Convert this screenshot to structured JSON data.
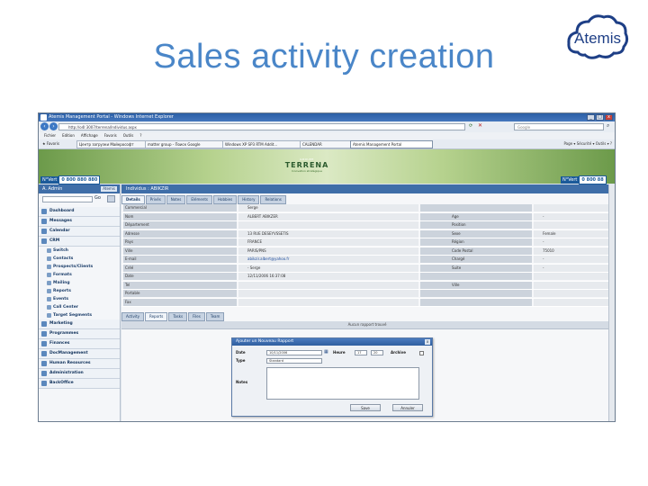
{
  "slide": {
    "title": "Sales activity creation",
    "logo_text": "Atemis"
  },
  "browser": {
    "window_title": "Atemis Management Portal - Windows Internet Explorer",
    "address": "http://o4l:3007/terrena/Individus.aspx",
    "search_placeholder": "Google",
    "menu": [
      "Fichier",
      "Edition",
      "Affichage",
      "Favoris",
      "Outils",
      "?"
    ],
    "favorites_label": "Favoris",
    "tabs": [
      "Центр загрузки Майкрософт",
      "matter group - Поиск Google",
      "Windows XP SP3 RTM Addit...",
      "CALENDAR",
      "Atemis Management Portal"
    ],
    "page_tools": "Page ▾  Sécurité ▾  Outils ▾  ?"
  },
  "banner": {
    "group_text": "GROUPE",
    "brand": "TERRENA",
    "tagline": "Innovation stratégique",
    "phone_tag": "N°Vert",
    "phone_number": "0 800 880 880",
    "phone_number_right": "0 800 88"
  },
  "sidebar": {
    "user": "A. Admin",
    "badge": "Atemis",
    "go_label": "Go",
    "items": [
      {
        "label": "Dashboard",
        "level": "top"
      },
      {
        "label": "Messages",
        "level": "top"
      },
      {
        "label": "Calendar",
        "level": "top"
      },
      {
        "label": "CRM",
        "level": "top"
      },
      {
        "label": "Switch",
        "level": "sub"
      },
      {
        "label": "Contacts",
        "level": "sub"
      },
      {
        "label": "Prospects/Clients",
        "level": "sub"
      },
      {
        "label": "Formats",
        "level": "sub"
      },
      {
        "label": "Mailing",
        "level": "sub"
      },
      {
        "label": "Reports",
        "level": "sub"
      },
      {
        "label": "Events",
        "level": "sub"
      },
      {
        "label": "Call Center",
        "level": "sub"
      },
      {
        "label": "Target Segments",
        "level": "sub"
      },
      {
        "label": "Marketing",
        "level": "top"
      },
      {
        "label": "Programmes",
        "level": "top"
      },
      {
        "label": "Finances",
        "level": "top"
      },
      {
        "label": "DocManagement",
        "level": "top"
      },
      {
        "label": "Human Resources",
        "level": "top"
      },
      {
        "label": "Administration",
        "level": "top"
      },
      {
        "label": "BackOffice",
        "level": "top"
      }
    ]
  },
  "content": {
    "heading": "Individus : ABIKZIR",
    "tabs": [
      "Details",
      "Privés",
      "Notes",
      "Eléments",
      "Hobbies",
      "History",
      "Relations"
    ],
    "fields": [
      {
        "label": "Commercial",
        "value": "Serge",
        "label2": "",
        "value2": ""
      },
      {
        "label": "Nom",
        "value": "ALBERT ABIKZER",
        "label2": "Age",
        "value2": "-"
      },
      {
        "label": "Département",
        "value": "",
        "label2": "Position",
        "value2": ""
      },
      {
        "label": "Adresse",
        "value": "13 RUE DESEYVSSETIS",
        "label2": "Sexe",
        "value2": "Female"
      },
      {
        "label": "Pays",
        "value": "FRANCE",
        "label2": "Région",
        "value2": "-"
      },
      {
        "label": "Ville",
        "value": "PARIS/PNS",
        "label2": "Code Postal",
        "value2": "75010"
      },
      {
        "label": "E-mail",
        "value": "abikzir.albert@yahoo.fr",
        "label2": "Chargé",
        "value2": "-"
      },
      {
        "label": "Créé",
        "value": "- Serge",
        "label2": "Suite",
        "value2": "-"
      },
      {
        "label": "Date",
        "value": "12/11/2006 16:37:08",
        "label2": "",
        "value2": ""
      },
      {
        "label": "Tel",
        "value": "",
        "label2": "Ville",
        "value2": ""
      },
      {
        "label": "Portable",
        "value": "",
        "label2": "",
        "value2": ""
      },
      {
        "label": "Fax",
        "value": "",
        "label2": "",
        "value2": ""
      }
    ],
    "sub_tabs": [
      "Activity",
      "Reports",
      "Tasks",
      "Files",
      "Team"
    ],
    "list_header": "Aucun rapport trouvé"
  },
  "modal": {
    "title": "Ajouter un Nouveau Rapport",
    "date_label": "Date",
    "date_value": "10/11/2006",
    "heure_label": "Heure",
    "hour_value": "17",
    "minute_value": "20",
    "archive_label": "Archive",
    "type_label": "Type",
    "type_value": "Standard",
    "notes_label": "Notes",
    "save_label": "Save",
    "cancel_label": "Annuler"
  }
}
